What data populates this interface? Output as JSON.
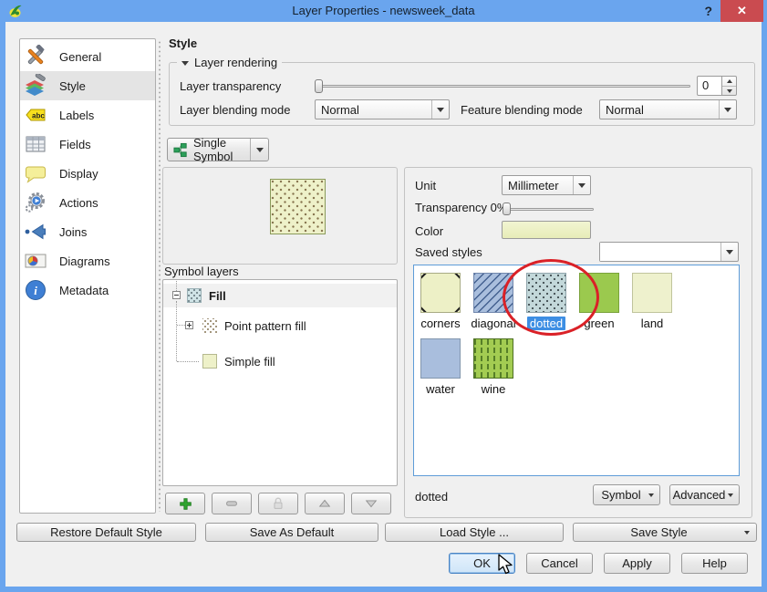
{
  "window": {
    "title": "Layer Properties - newsweek_data",
    "help_glyph": "?",
    "close_glyph": "✕"
  },
  "sidebar": {
    "items": [
      {
        "label": "General"
      },
      {
        "label": "Style"
      },
      {
        "label": "Labels"
      },
      {
        "label": "Fields"
      },
      {
        "label": "Display"
      },
      {
        "label": "Actions"
      },
      {
        "label": "Joins"
      },
      {
        "label": "Diagrams"
      },
      {
        "label": "Metadata"
      }
    ]
  },
  "icons": {
    "labels_glyph": "abc",
    "metadata_glyph": "i"
  },
  "style_tab": {
    "header": "Style",
    "layer_rendering": {
      "legend": "Layer rendering",
      "transparency_label": "Layer transparency",
      "transparency_value": "0",
      "layer_blend_label": "Layer blending mode",
      "layer_blend_value": "Normal",
      "feature_blend_label": "Feature blending mode",
      "feature_blend_value": "Normal"
    },
    "renderer_label": "Single Symbol",
    "symbol_layers_label": "Symbol layers",
    "tree": {
      "root_label": "Fill",
      "child1_label": "Point pattern fill",
      "child2_label": "Simple fill"
    }
  },
  "symbol_panel": {
    "unit_label": "Unit",
    "unit_value": "Millimeter",
    "transparency_label": "Transparency 0%",
    "color_label": "Color",
    "saved_styles_label": "Saved styles",
    "styles": [
      {
        "label": "corners"
      },
      {
        "label": "diagonal"
      },
      {
        "label": "dotted"
      },
      {
        "label": "green"
      },
      {
        "label": "land"
      },
      {
        "label": "water"
      },
      {
        "label": "wine"
      }
    ],
    "selected_style": "dotted",
    "symbol_menu_label": "Symbol",
    "advanced_menu_label": "Advanced"
  },
  "footer": {
    "restore_default": "Restore Default Style",
    "save_as_default": "Save As Default",
    "load_style": "Load Style ...",
    "save_style": "Save Style",
    "ok": "OK",
    "cancel": "Cancel",
    "apply": "Apply",
    "help": "Help"
  },
  "colors": {
    "titlebar_blue": "#6aa5ee",
    "close_red": "#ca4b50",
    "selection_blue": "#3d8ee3",
    "annotation_red": "#da2127",
    "pale_yellow": "#edf0c6",
    "dotted_blue": "#c3d8da",
    "hatch_blue": "#a9bedd",
    "green": "#9bc94e",
    "land_yellow": "#eef1cd",
    "water_blue": "#a9bedd",
    "wine_green": "#a3cc52"
  }
}
